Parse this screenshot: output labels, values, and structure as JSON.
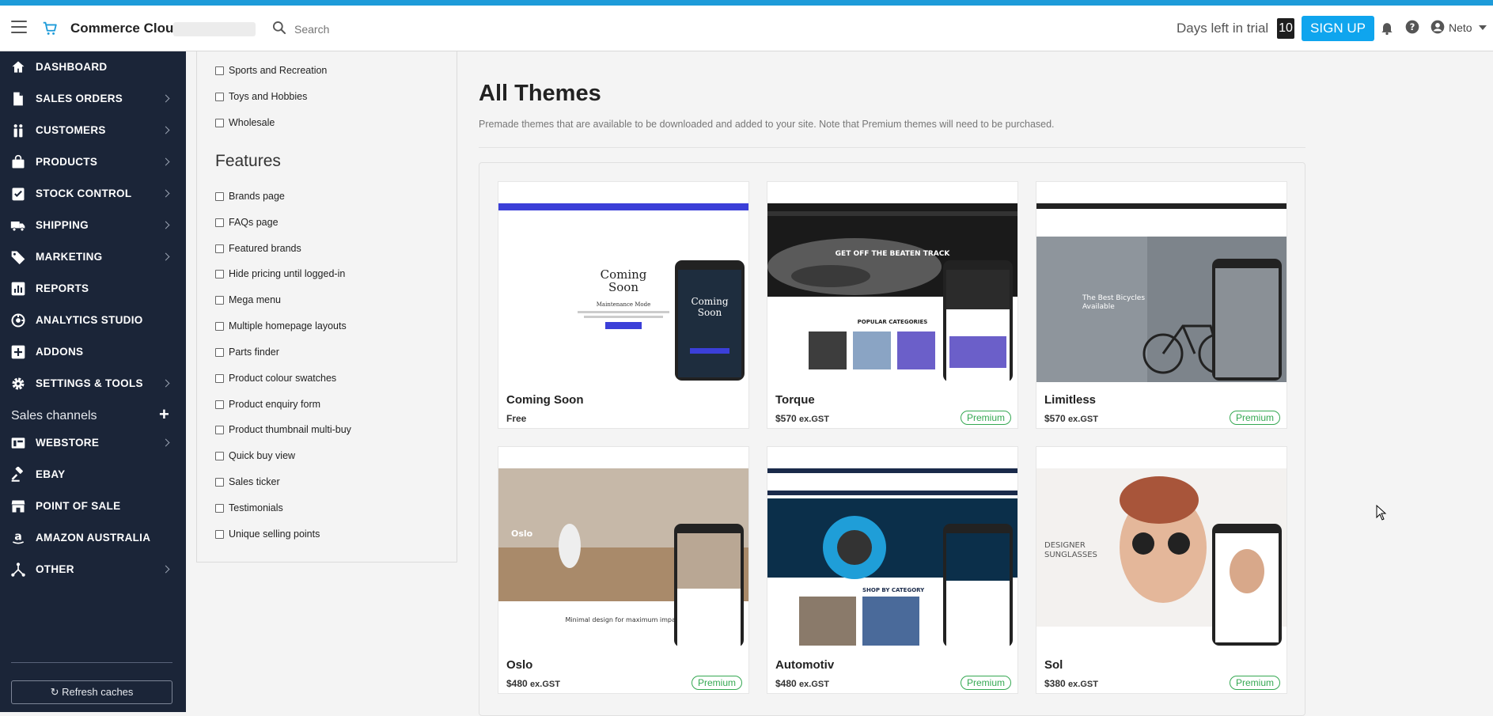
{
  "topbar": {
    "brand": "Commerce Cloud",
    "search_placeholder": "Search",
    "trial_label": "Days left in trial",
    "days_left": "10",
    "signup_label": "SIGN UP",
    "user_name": "Neto",
    "accent": "#1d9bd9"
  },
  "sidebar": {
    "items": [
      {
        "label": "DASHBOARD",
        "icon": "home-icon",
        "chevron": false
      },
      {
        "label": "SALES ORDERS",
        "icon": "document-icon",
        "chevron": true
      },
      {
        "label": "CUSTOMERS",
        "icon": "people-icon",
        "chevron": true
      },
      {
        "label": "PRODUCTS",
        "icon": "bag-icon",
        "chevron": true
      },
      {
        "label": "STOCK CONTROL",
        "icon": "checklist-icon",
        "chevron": true
      },
      {
        "label": "SHIPPING",
        "icon": "truck-icon",
        "chevron": true
      },
      {
        "label": "MARKETING",
        "icon": "tag-icon",
        "chevron": true
      },
      {
        "label": "REPORTS",
        "icon": "bar-chart-icon",
        "chevron": false
      },
      {
        "label": "ANALYTICS STUDIO",
        "icon": "analytics-icon",
        "chevron": false
      },
      {
        "label": "ADDONS",
        "icon": "plus-box-icon",
        "chevron": false
      },
      {
        "label": "SETTINGS & TOOLS",
        "icon": "gear-icon",
        "chevron": true
      }
    ],
    "sales_channels_label": "Sales channels",
    "channels": [
      {
        "label": "WEBSTORE",
        "icon": "webstore-icon",
        "chevron": true
      },
      {
        "label": "EBAY",
        "icon": "gavel-icon",
        "chevron": false
      },
      {
        "label": "POINT OF SALE",
        "icon": "store-icon",
        "chevron": false
      },
      {
        "label": "AMAZON AUSTRALIA",
        "icon": "amazon-icon",
        "chevron": false
      },
      {
        "label": "OTHER",
        "icon": "fork-icon",
        "chevron": true
      }
    ],
    "refresh_label": "Refresh caches",
    "bg_color": "#1b2538"
  },
  "filters": {
    "industries": [
      "Sports and Recreation",
      "Toys and Hobbies",
      "Wholesale"
    ],
    "features_title": "Features",
    "features": [
      "Brands page",
      "FAQs page",
      "Featured brands",
      "Hide pricing until logged-in",
      "Mega menu",
      "Multiple homepage layouts",
      "Parts finder",
      "Product colour swatches",
      "Product enquiry form",
      "Product thumbnail multi-buy",
      "Quick buy view",
      "Sales ticker",
      "Testimonials",
      "Unique selling points"
    ]
  },
  "main": {
    "title": "All Themes",
    "description": "Premade themes that are available to be downloaded and added to your site. Note that Premium themes will need to be purchased.",
    "themes": [
      {
        "name": "Coming Soon",
        "price": "Free",
        "price_suffix": "",
        "badge": ""
      },
      {
        "name": "Torque",
        "price": "$570",
        "price_suffix": "ex.GST",
        "badge": "Premium"
      },
      {
        "name": "Limitless",
        "price": "$570",
        "price_suffix": "ex.GST",
        "badge": "Premium"
      },
      {
        "name": "Oslo",
        "price": "$480",
        "price_suffix": "ex.GST",
        "badge": "Premium"
      },
      {
        "name": "Automotiv",
        "price": "$480",
        "price_suffix": "ex.GST",
        "badge": "Premium"
      },
      {
        "name": "Sol",
        "price": "$380",
        "price_suffix": "ex.GST",
        "badge": "Premium"
      }
    ],
    "badge_color": "#35a852"
  }
}
